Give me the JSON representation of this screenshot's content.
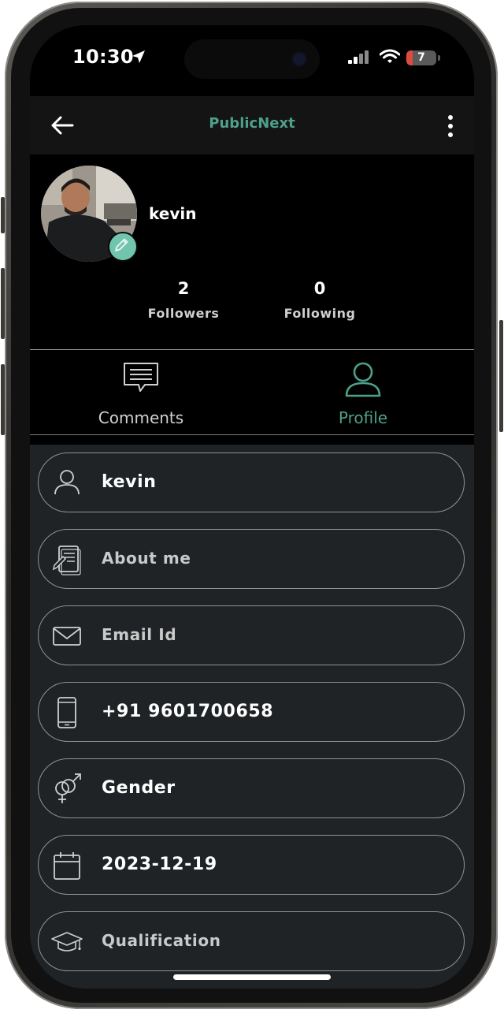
{
  "status_bar": {
    "time": "10:30",
    "battery": "7"
  },
  "app_bar": {
    "title": "PublicNext"
  },
  "profile": {
    "username": "kevin",
    "followers": {
      "count": "2",
      "label": "Followers"
    },
    "following": {
      "count": "0",
      "label": "Following"
    }
  },
  "tabs": [
    {
      "label": "Comments",
      "icon": "comment-icon",
      "active": false
    },
    {
      "label": "Profile",
      "icon": "person-icon",
      "active": true
    }
  ],
  "fields": {
    "name": "kevin",
    "about": "About me",
    "email": "Email Id",
    "phone": "+91 9601700658",
    "gender": "Gender",
    "dob": "2023-12-19",
    "qualification": "Qualification"
  },
  "colors": {
    "accent": "#4ea08b",
    "panel": "#1f2325",
    "background": "#000000"
  }
}
